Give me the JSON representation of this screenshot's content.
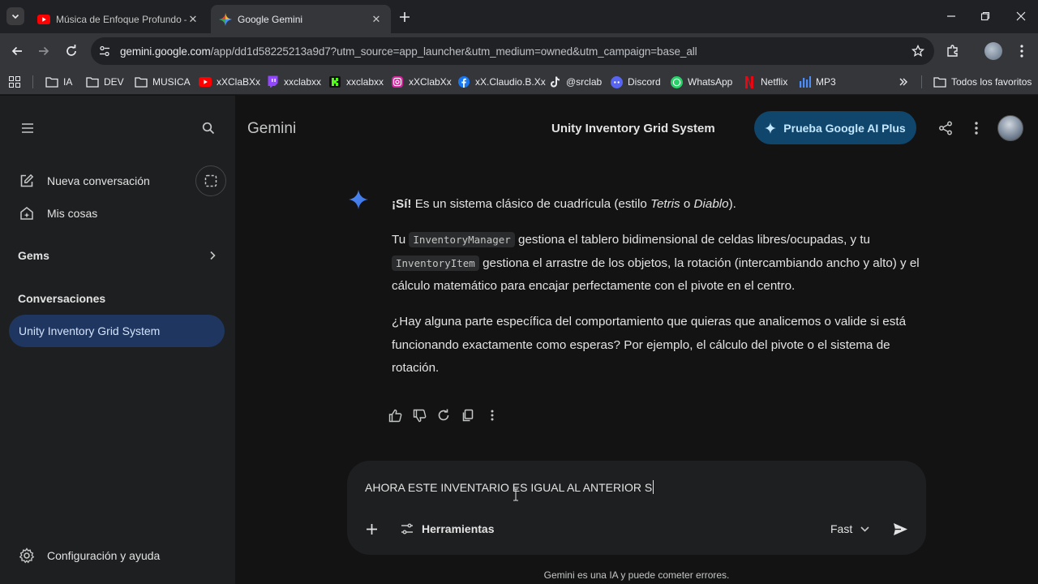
{
  "browser": {
    "tabs": [
      {
        "title": "Música de Enfoque Profundo –",
        "icon": "youtube-icon",
        "active": false
      },
      {
        "title": "Google Gemini",
        "icon": "gemini-icon",
        "active": true
      }
    ],
    "url_host": "gemini.google.com",
    "url_rest": "/app/dd1d58225213a9d7?utm_source=app_launcher&utm_medium=owned&utm_campaign=base_all",
    "bookmarks": [
      {
        "label": "IA",
        "icon": "folder-icon"
      },
      {
        "label": "DEV",
        "icon": "folder-icon"
      },
      {
        "label": "MUSICA",
        "icon": "folder-icon"
      },
      {
        "label": "xXClaBXx",
        "icon": "youtube-icon"
      },
      {
        "label": "xxclabxx",
        "icon": "twitch-icon"
      },
      {
        "label": "xxclabxx",
        "icon": "kick-icon"
      },
      {
        "label": "xXClabXx",
        "icon": "instagram-icon"
      },
      {
        "label": "xX.Claudio.B.Xx",
        "icon": "facebook-icon"
      },
      {
        "label": "@srclab",
        "icon": "tiktok-icon"
      },
      {
        "label": "Discord",
        "icon": "discord-icon"
      },
      {
        "label": "WhatsApp",
        "icon": "whatsapp-icon"
      },
      {
        "label": "Netflix",
        "icon": "netflix-icon"
      },
      {
        "label": "MP3",
        "icon": "mp3-icon"
      }
    ],
    "all_bookmarks": "Todos los favoritos"
  },
  "sidebar": {
    "new_chat": "Nueva conversación",
    "my_stuff": "Mis cosas",
    "gems": "Gems",
    "conversations_title": "Conversaciones",
    "conversations": [
      "Unity Inventory Grid System"
    ],
    "settings": "Configuración y ayuda"
  },
  "header": {
    "brand": "Gemini",
    "conversation_title": "Unity Inventory Grid System",
    "upgrade_button": "Prueba Google AI Plus"
  },
  "response": {
    "p1_lead": "¡Sí!",
    "p1_text_a": " Es un sistema clásico de cuadrícula (estilo ",
    "p1_em1": "Tetris",
    "p1_text_b": " o ",
    "p1_em2": "Diablo",
    "p1_text_c": ").",
    "p2_a": "Tu ",
    "p2_code1": "InventoryManager",
    "p2_b": " gestiona el tablero bidimensional de celdas libres/ocupadas, y tu ",
    "p2_code2": "InventoryItem",
    "p2_c": " gestiona el arrastre de los objetos, la rotación (intercambiando ancho y alto) y el cálculo matemático para encajar perfectamente con el pivote en el centro.",
    "p3": "¿Hay alguna parte específica del comportamiento que quieras que analicemos o valide si está funcionando exactamente como esperas? Por ejemplo, el cálculo del pivote o el sistema de rotación."
  },
  "composer": {
    "input_text": "AHORA ESTE INVENTARIO ES IGUAL AL ANTERIOR S",
    "tools_label": "Herramientas",
    "model_label": "Fast"
  },
  "footer": {
    "disclaimer": "Gemini es una IA y puede cometer errores."
  }
}
